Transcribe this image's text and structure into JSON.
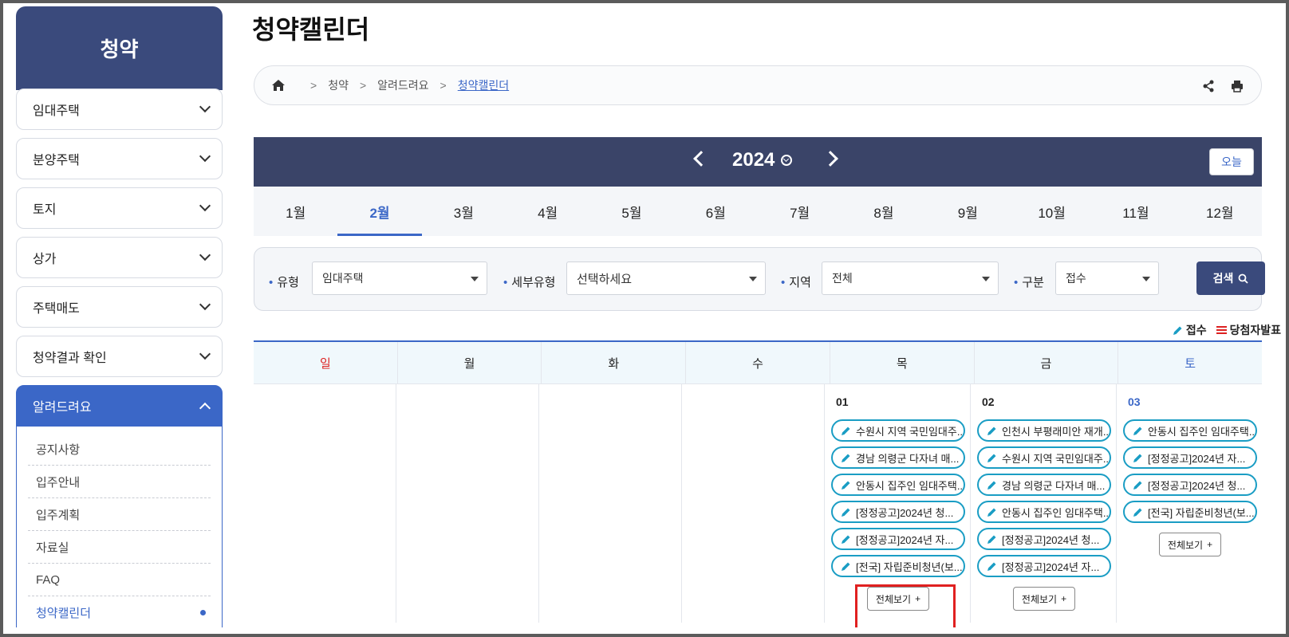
{
  "sidebar": {
    "title": "청약",
    "items": [
      {
        "label": "임대주택"
      },
      {
        "label": "분양주택"
      },
      {
        "label": "토지"
      },
      {
        "label": "상가"
      },
      {
        "label": "주택매도"
      },
      {
        "label": "청약결과 확인"
      }
    ],
    "active": {
      "label": "알려드려요"
    },
    "sub_items": [
      {
        "label": "공지사항"
      },
      {
        "label": "입주안내"
      },
      {
        "label": "입주계획"
      },
      {
        "label": "자료실"
      },
      {
        "label": "FAQ"
      },
      {
        "label": "청약캘린더"
      }
    ]
  },
  "page": {
    "title": "청약캘린더"
  },
  "breadcrumb": {
    "items": [
      "청약",
      "알려드려요",
      "청약캘린더"
    ]
  },
  "calendar": {
    "year": "2024",
    "today_label": "오늘",
    "months": [
      "1월",
      "2월",
      "3월",
      "4월",
      "5월",
      "6월",
      "7월",
      "8월",
      "9월",
      "10월",
      "11월",
      "12월"
    ],
    "active_month": "2월",
    "weekdays": [
      "일",
      "월",
      "화",
      "수",
      "목",
      "금",
      "토"
    ]
  },
  "filters": {
    "type_label": "유형",
    "type_value": "임대주택",
    "subtype_label": "세부유형",
    "subtype_value": "선택하세요",
    "region_label": "지역",
    "region_value": "전체",
    "category_label": "구분",
    "category_value": "접수",
    "search_label": "검색"
  },
  "legend": {
    "apply": "접수",
    "winner": "당첨자발표"
  },
  "days": {
    "thu": {
      "num": "01",
      "events": [
        "수원시 지역 국민임대주...",
        "경남 의령군 다자녀 매...",
        "안동시 집주인 임대주택...",
        "[정정공고]2024년 청...",
        "[정정공고]2024년 자...",
        "[전국] 자립준비청년(보..."
      ],
      "more": "전체보기"
    },
    "fri": {
      "num": "02",
      "events": [
        "인천시 부평래미안 재개...",
        "수원시 지역 국민임대주...",
        "경남 의령군 다자녀 매...",
        "안동시 집주인 임대주택...",
        "[정정공고]2024년 청...",
        "[정정공고]2024년 자..."
      ],
      "more": "전체보기"
    },
    "sat": {
      "num": "03",
      "events": [
        "안동시 집주인 임대주택...",
        "[정정공고]2024년 자...",
        "[정정공고]2024년 청...",
        "[전국] 자립준비청년(보..."
      ],
      "more": "전체보기"
    }
  },
  "colors": {
    "primary": "#3a4a7c",
    "accent": "#3b67c7",
    "event_border": "#1a9dc4",
    "highlight": "#e02020"
  }
}
